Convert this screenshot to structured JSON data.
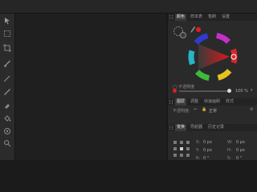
{
  "panel": {
    "color_tabs": [
      "颜色",
      "样本表",
      "笔刷",
      "设置"
    ],
    "color_opacity": "100 %",
    "layers_tabs": [
      "图层",
      "调整",
      "快速画刷",
      "样式"
    ],
    "blend_mode": "正常",
    "opacity_label": "不透明度:",
    "nav_tabs": [
      "变换",
      "导航器",
      "历史记录"
    ],
    "transform": {
      "x": "0 px",
      "y": "0 px",
      "w": "0 px",
      "h": "0 px",
      "r": "0 °",
      "s": "0 °"
    }
  },
  "colors": {
    "primary": "#e31b23",
    "accent_panel": "#2a2a2a"
  },
  "tools": [
    "move-icon",
    "select-icon",
    "crop-icon",
    "brush-icon",
    "pen-icon",
    "pencil-icon",
    "eraser-icon",
    "fill-icon",
    "text-icon",
    "zoom-icon"
  ]
}
